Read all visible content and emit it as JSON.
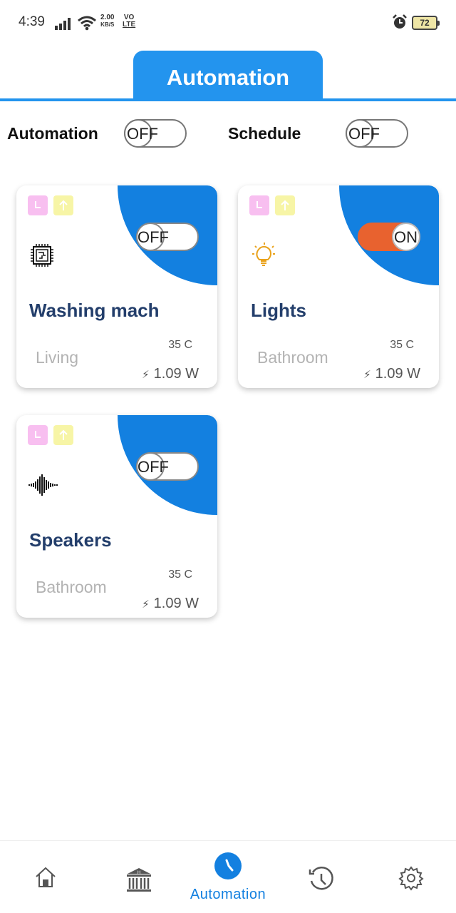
{
  "status_bar": {
    "time": "4:39",
    "speed_value": "2.00",
    "speed_unit": "KB/S",
    "volte_top": "VO",
    "volte_bottom": "LTE",
    "battery": "72"
  },
  "header": {
    "tab_title": "Automation",
    "accent_color": "#2394ee"
  },
  "controls": {
    "automation_label": "Automation",
    "automation_state": "OFF",
    "schedule_label": "Schedule",
    "schedule_state": "OFF"
  },
  "devices": [
    {
      "name": "Washing mach",
      "room": "Living",
      "temp": "35 C",
      "power": "1.09 W",
      "state": "OFF",
      "icon": "circuit-chip-icon"
    },
    {
      "name": "Lights",
      "room": "Bathroom",
      "temp": "35 C",
      "power": "1.09 W",
      "state": "ON",
      "icon": "light-bulb-icon"
    },
    {
      "name": "Speakers",
      "room": "Bathroom",
      "temp": "35 C",
      "power": "1.09 W",
      "state": "OFF",
      "icon": "sound-wave-icon"
    }
  ],
  "bottom_nav": {
    "items": [
      "home-icon",
      "building-icon",
      "clock-icon",
      "history-icon",
      "settings-icon"
    ],
    "active_label": "Automation"
  }
}
